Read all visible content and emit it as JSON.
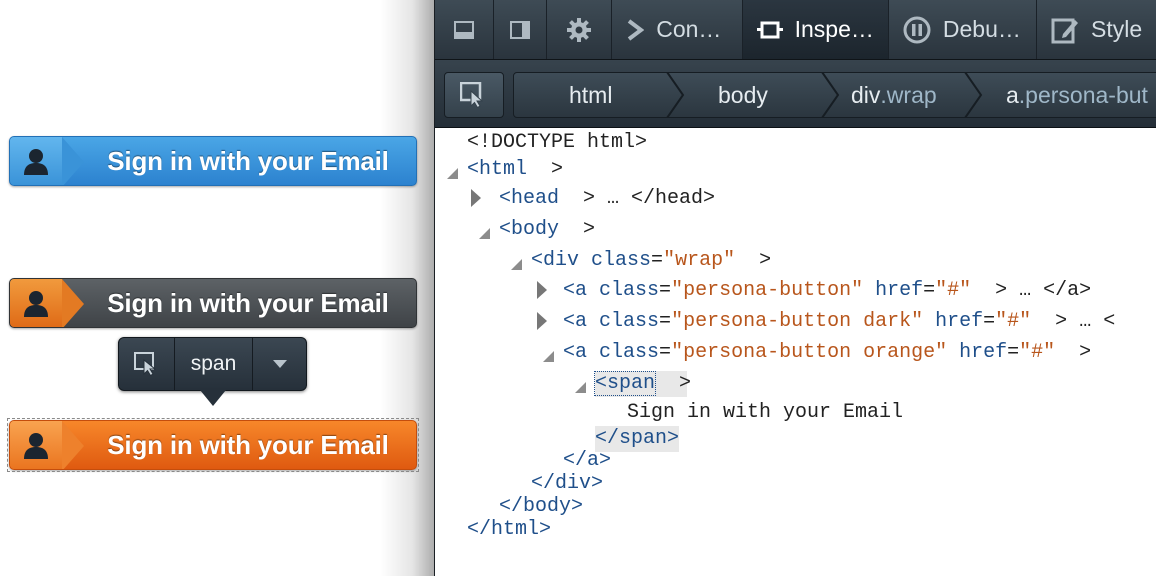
{
  "page": {
    "buttons": [
      {
        "label": "Sign in with your Email",
        "style": "blue"
      },
      {
        "label": "Sign in with your Email",
        "style": "dark"
      },
      {
        "label": "Sign in with your Email",
        "style": "orange"
      }
    ],
    "infobar": {
      "tag": "span"
    }
  },
  "devtools": {
    "tabs": {
      "console": "Con…",
      "inspector": "Inspe…",
      "debugger": "Debu…",
      "style": "Style"
    },
    "breadcrumbs": {
      "html": "html",
      "body": "body",
      "div_tag": "div",
      "div_class": ".wrap",
      "a_tag": "a",
      "a_class": ".persona-but"
    },
    "markup": {
      "doctype": "<!DOCTYPE html>",
      "html_open": "<html",
      "html_close": "</html>",
      "head_open": "<head",
      "head_close": " … </head>",
      "body_open": "<body",
      "body_close": "</body>",
      "div_open": "<div",
      "div_class_attr": "class",
      "div_class_val": "\"wrap\"",
      "div_close": "</div>",
      "a_open": "<a",
      "class_attr": "class",
      "href_attr": "href",
      "href_val": "\"#\"",
      "a1_class": "\"persona-button\"",
      "a2_class": "\"persona-button dark\"",
      "a3_class": "\"persona-button orange\"",
      "a_collapsed_tail": " … </a>",
      "a2_collapsed_tail": " … <",
      "a_close": "</a>",
      "span_open": "span",
      "span_text": "Sign in with your Email",
      "span_close": "</span>"
    }
  },
  "colors": {
    "tag": "#1f4f8a",
    "value": "#b8561c",
    "toolbar": "#2a343d",
    "blue_button": "#2c82cf",
    "orange_button": "#df5a10"
  }
}
